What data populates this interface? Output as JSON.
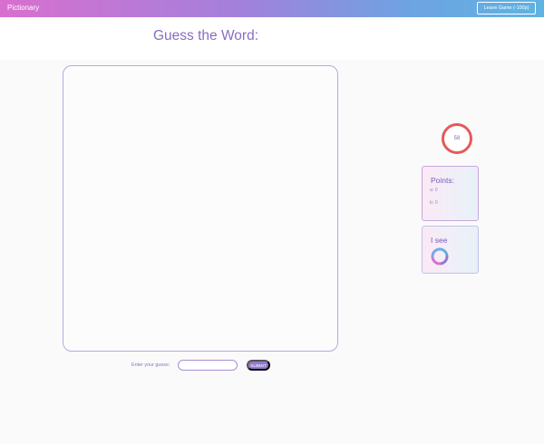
{
  "app": {
    "title": "Pictionary",
    "leave_label": "Leave Game (-100p)"
  },
  "header": {
    "title": "Guess the Word:"
  },
  "guess": {
    "label": "Enter your guess:",
    "value": "",
    "placeholder": "",
    "submit_label": "SUBMIT"
  },
  "timer": {
    "value": "58"
  },
  "points": {
    "title": "Points:",
    "players": [
      {
        "line": "a: 0"
      },
      {
        "line": "b: 0"
      }
    ]
  },
  "see": {
    "title": "I see"
  },
  "colors": {
    "accent": "#8a6cc4",
    "timer": "#e45a5a",
    "submit": "#9379cf"
  }
}
